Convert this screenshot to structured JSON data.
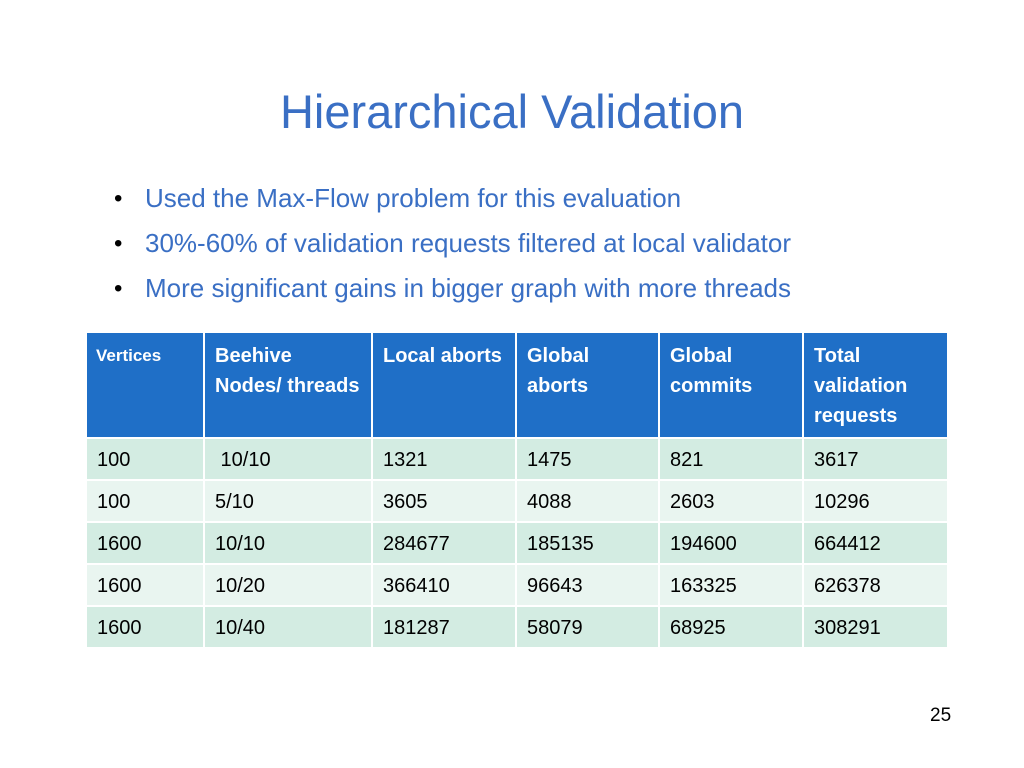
{
  "slide": {
    "title": "Hierarchical Validation",
    "bullets": [
      "Used the Max-Flow problem for this evaluation",
      "30%-60% of validation requests filtered  at local validator",
      "More significant gains in bigger graph with more threads"
    ],
    "bullet_glyph": "•",
    "page_number": "25"
  },
  "table": {
    "headers": [
      "Vertices",
      "Beehive Nodes/ threads",
      "Local aborts",
      "Global aborts",
      "Global commits",
      "Total validation requests"
    ],
    "rows": [
      [
        "100",
        " 10/10",
        "1321",
        "1475",
        "821",
        "3617"
      ],
      [
        "100",
        "5/10",
        "3605",
        "4088",
        "2603",
        "10296"
      ],
      [
        "1600",
        "10/10",
        "284677",
        "185135",
        "194600",
        "664412"
      ],
      [
        "1600",
        "10/20",
        "366410",
        "96643",
        "163325",
        "626378"
      ],
      [
        "1600",
        "10/40",
        "181287",
        "58079",
        "68925",
        "308291"
      ]
    ]
  },
  "colors": {
    "title": "#3a6fc4",
    "header_bg": "#1f6fc7",
    "row_odd": "#d3ece2",
    "row_even": "#e9f5f0"
  }
}
